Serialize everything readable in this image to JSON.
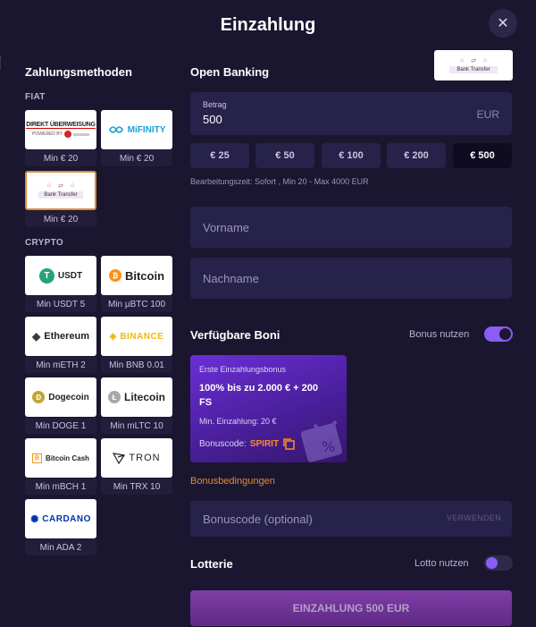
{
  "modal": {
    "title": "Einzahlung",
    "close": "✕"
  },
  "methods": {
    "heading": "Zahlungsmethoden",
    "fiat_label": "FIAT",
    "crypto_label": "CRYPTO",
    "fiat": [
      {
        "name": "DIREKT ÜBERWEISUNG",
        "sub": "POWERED BY",
        "caption": "Min € 20"
      },
      {
        "name": "MiFINITY",
        "caption": "Min € 20"
      },
      {
        "name": "Bank Transfer",
        "caption": "Min € 20"
      }
    ],
    "crypto": [
      {
        "name": "USDT",
        "caption": "Min USDT 5"
      },
      {
        "name": "Bitcoin",
        "caption": "Min µBTC 100"
      },
      {
        "name": "Ethereum",
        "caption": "Min mETH 2"
      },
      {
        "name": "BINANCE",
        "caption": "Min BNB 0.01"
      },
      {
        "name": "Dogecoin",
        "caption": "Min DOGE 1"
      },
      {
        "name": "Litecoin",
        "caption": "Min mLTC 10"
      },
      {
        "name": "Bitcoin Cash",
        "caption": "Min mBCH 1"
      },
      {
        "name": "TRON",
        "caption": "Min TRX 10"
      },
      {
        "name": "CARDANO",
        "caption": "Min ADA 2"
      }
    ]
  },
  "payment": {
    "heading": "Open Banking",
    "logo_text": "Bank Transfer",
    "amount_label": "Betrag",
    "amount_value": "500",
    "currency": "EUR",
    "chips": [
      "€ 25",
      "€ 50",
      "€ 100",
      "€ 200",
      "€ 500"
    ],
    "active_chip": "€ 500",
    "info": "Bearbeitungszeit: Sofort , Min 20 - Max 4000 EUR",
    "first_name_placeholder": "Vorname",
    "last_name_placeholder": "Nachname"
  },
  "bonus": {
    "heading": "Verfügbare Boni",
    "toggle_label": "Bonus nutzen",
    "toggle_on": true,
    "card_subtitle": "Erste Einzahlungsbonus",
    "card_title": "100% bis zu 2.000 € + 200 FS",
    "card_min": "Min. Einzahlung: 20 €",
    "card_code_label": "Bonuscode:",
    "card_code": "SPIRIT",
    "terms_link": "Bonusbedingungen",
    "code_placeholder": "Bonuscode (optional)",
    "verify": "VERWENDEN"
  },
  "lottery": {
    "heading": "Lotterie",
    "toggle_label": "Lotto nutzen",
    "toggle_on": false
  },
  "submit": {
    "label": "EINZAHLUNG 500 EUR"
  },
  "colors": {
    "background": "#1a1630",
    "field": "#27224a",
    "accent_purple": "#8b5cf6",
    "accent_orange": "#e08a3a"
  }
}
